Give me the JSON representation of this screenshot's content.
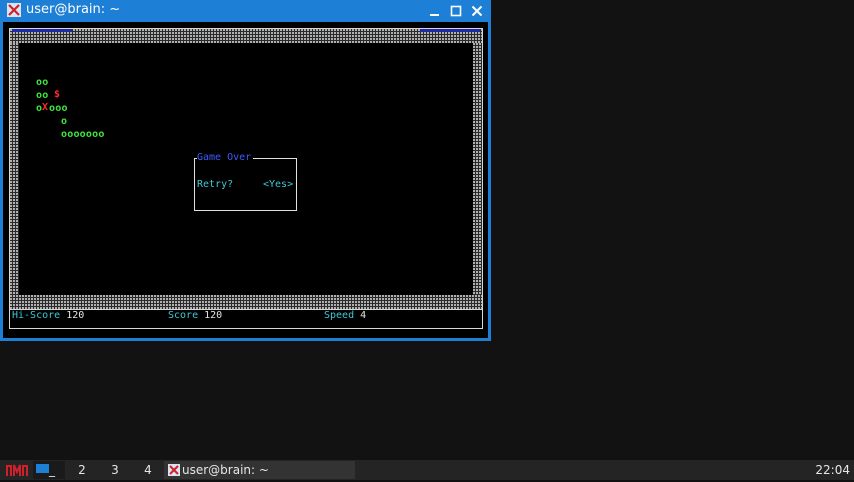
{
  "window": {
    "title": "user@brain: ~",
    "icon": "x-terminal-icon",
    "controls": {
      "minimize": "—",
      "maximize": "☐",
      "close": "✕"
    }
  },
  "game": {
    "snake": [
      {
        "text": "oo",
        "color": "green"
      },
      {
        "text": "oo",
        "color": "green"
      },
      {
        "text": "$",
        "color": "red"
      },
      {
        "text": "o",
        "color": "green"
      },
      {
        "text": "X",
        "color": "red"
      },
      {
        "text": "ooo",
        "color": "green"
      },
      {
        "text": "o",
        "color": "green"
      },
      {
        "text": "ooooooo",
        "color": "green"
      }
    ],
    "dialog": {
      "title": "Game Over",
      "question": "Retry?",
      "button": "<Yes>"
    },
    "status": {
      "hiscore_label": "Hi-Score",
      "hiscore_value": "120",
      "score_label": "Score",
      "score_value": "120",
      "speed_label": "Speed",
      "speed_value": "4"
    },
    "colors": {
      "snake": "#3fe63f",
      "food": "#ff2a2a",
      "label": "#3cc8d8",
      "title": "#3d5bff"
    }
  },
  "taskbar": {
    "start_label": "JM",
    "workspaces": [
      "_",
      "2",
      "3",
      "4"
    ],
    "task_label": "user@brain: ~",
    "clock": "22:04"
  }
}
